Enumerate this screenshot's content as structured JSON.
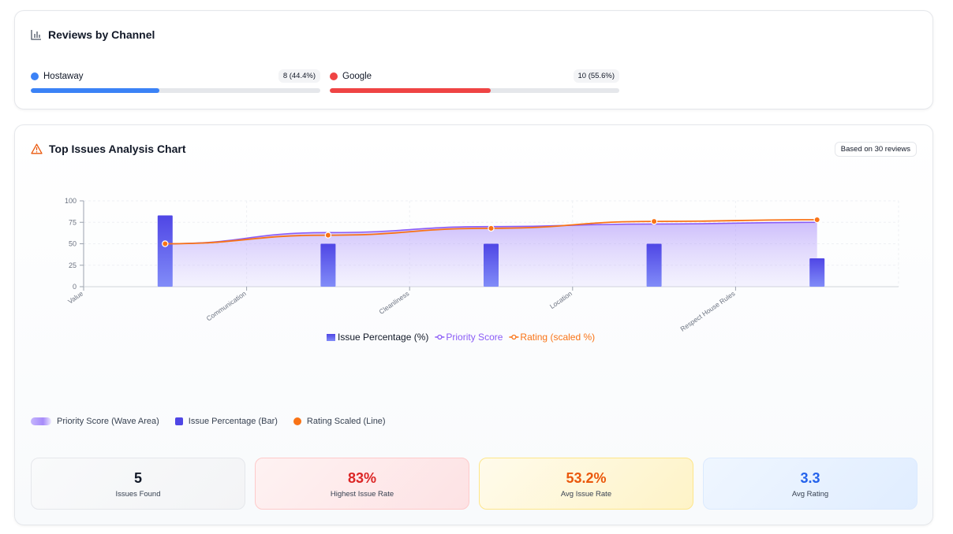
{
  "channels_card": {
    "title": "Reviews by Channel",
    "channels": [
      {
        "name": "Hostaway",
        "badge": "8 (44.4%)",
        "share": 0.444,
        "color": "#3b82f6"
      },
      {
        "name": "Google",
        "badge": "10 (55.6%)",
        "share": 0.556,
        "color": "#ef4444"
      }
    ]
  },
  "issues_card": {
    "title": "Top Issues Analysis Chart",
    "reviews_pill": "Based on 30 reviews",
    "legend_bottom": {
      "wave": "Priority Score (Wave Area)",
      "bar": "Issue Percentage (Bar)",
      "line": "Rating Scaled (Line)"
    },
    "stats": {
      "found": {
        "value": "5",
        "label": "Issues Found",
        "color": "#111827"
      },
      "highest": {
        "value": "83%",
        "label": "Highest Issue Rate",
        "color": "#dc2626"
      },
      "avg_rate": {
        "value": "53.2%",
        "label": "Avg Issue Rate",
        "color": "#ea580c"
      },
      "avg_rating": {
        "value": "3.3",
        "label": "Avg Rating",
        "color": "#2563eb"
      }
    }
  },
  "chart_data": {
    "type": "bar",
    "categories": [
      "Value",
      "Communication",
      "Cleanliness",
      "Location",
      "Respect House Rules"
    ],
    "series": [
      {
        "name": "Issue Percentage (%)",
        "kind": "bar",
        "color": "#6366f1",
        "values": [
          83,
          50,
          50,
          50,
          33
        ]
      },
      {
        "name": "Priority Score",
        "kind": "area",
        "color": "#8b5cf6",
        "values": [
          50,
          63,
          70,
          73,
          75
        ]
      },
      {
        "name": "Rating (scaled %)",
        "kind": "line",
        "color": "#f97316",
        "values": [
          50,
          60,
          68,
          76,
          78
        ]
      }
    ],
    "ylim": [
      0,
      100
    ],
    "yticks": [
      "0",
      "25",
      "50",
      "75",
      "100"
    ],
    "grid": true,
    "legend": "bottom"
  }
}
